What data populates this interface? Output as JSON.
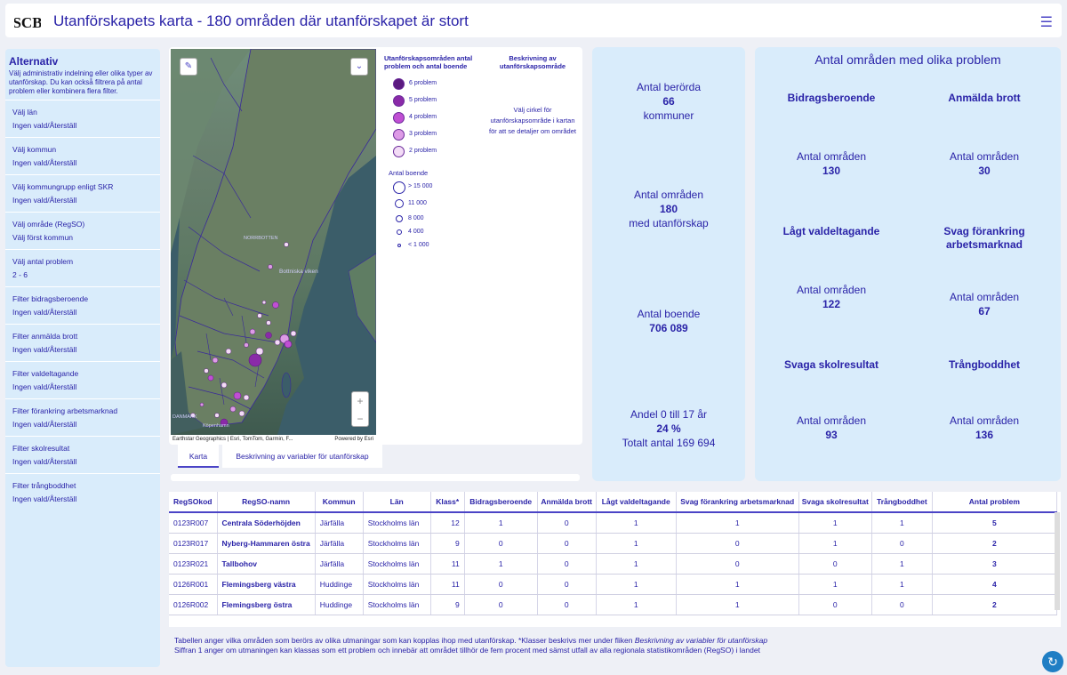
{
  "header": {
    "logo_text": "SCB",
    "title": "Utanförskapets karta - 180 områden där utanförskapet är stort",
    "menu_icon": "hamburger-icon"
  },
  "sidebar": {
    "title": "Alternativ",
    "description": "Välj  administrativ indelning eller olika typer av utanförskap. Du kan också filtrera på antal problem eller kombinera flera filter.",
    "items": [
      {
        "label": "Välj län",
        "value": "Ingen vald/Återställ"
      },
      {
        "label": "Välj kommun",
        "value": "Ingen vald/Återställ"
      },
      {
        "label": "Välj kommungrupp enligt SKR",
        "value": "Ingen vald/Återställ"
      },
      {
        "label": "Välj område (RegSO)",
        "value": "Välj först kommun"
      },
      {
        "label": "Välj antal problem",
        "value": "2 - 6"
      },
      {
        "label": "Filter bidragsberoende",
        "value": "Ingen vald/Återställ"
      },
      {
        "label": "Filter anmälda brott",
        "value": "Ingen vald/Återställ"
      },
      {
        "label": "Filter valdeltagande",
        "value": "Ingen vald/Återställ"
      },
      {
        "label": "Filter förankring arbetsmarknad",
        "value": "Ingen vald/Återställ"
      },
      {
        "label": "Filter skolresultat",
        "value": "Ingen vald/Återställ"
      },
      {
        "label": "Filter trångboddhet",
        "value": "Ingen vald/Återställ"
      }
    ]
  },
  "map": {
    "labels": {
      "bothnian": "Bottniska viken",
      "norrbotten": "NORRBOTTEN",
      "danmark": "DANMARK",
      "kopenhamn": "Köpenhamn"
    },
    "attribution": "Earthstar Geographics | Esri, TomTom, Garmin, F...",
    "powered": "Powered by Esri",
    "zoom_in": "+",
    "zoom_out": "−",
    "tool_icons": [
      "pencil-icon",
      "chevron-down-icon"
    ]
  },
  "legend": {
    "title": "Utanförskapsområden antal problem och antal boende",
    "problems": [
      {
        "label": "6 problem",
        "color": "#5b1a80"
      },
      {
        "label": "5 problem",
        "color": "#8a2aa8"
      },
      {
        "label": "4 problem",
        "color": "#c04fd3"
      },
      {
        "label": "3 problem",
        "color": "#dd9be6"
      },
      {
        "label": "2 problem",
        "color": "#f3dcf6"
      }
    ],
    "size_title": "Antal boende",
    "sizes": [
      "> 15 000",
      "11 000",
      "8 000",
      "4 000",
      "< 1 000"
    ],
    "desc_title": "Beskrivning av utanförskapsområde",
    "desc_text": "Välj cirkel för utanförskapsområde i kartan för att se detaljer om området"
  },
  "tabs": [
    "Karta",
    "Beskrivning av variabler för utanförskap"
  ],
  "stats": {
    "s1_top": "Antal berörda",
    "s1_val": "66",
    "s1_bottom": "kommuner",
    "s2_top": "Antal områden",
    "s2_val": "180",
    "s2_bottom": "med utanförskap",
    "s3_top": "Antal boende",
    "s3_val": "706 089",
    "s4_top": "Andel 0 till 17 år",
    "s4_val": "24 %",
    "s4_bottom": "Totalt antal 169 694"
  },
  "problems": {
    "title": "Antal områden med olika problem",
    "area_label": "Antal områden",
    "items": [
      {
        "name": "Bidragsberoende",
        "value": "130"
      },
      {
        "name": "Anmälda brott",
        "value": "30"
      },
      {
        "name": "Lågt valdeltagande",
        "value": "122"
      },
      {
        "name": "Svag förankring arbetsmarknad",
        "value": "67"
      },
      {
        "name": "Svaga skolresultat",
        "value": "93"
      },
      {
        "name": "Trångboddhet",
        "value": "136"
      }
    ]
  },
  "table": {
    "headers": [
      "RegSOkod",
      "RegSO-namn",
      "Kommun",
      "Län",
      "Klass*",
      "Bidragsberoende",
      "Anmälda brott",
      "Lågt valdeltagande",
      "Svag förankring arbetsmarknad",
      "Svaga skolresultat",
      "Trångboddhet",
      "Antal problem"
    ],
    "rows": [
      [
        "0123R007",
        "Centrala Söderhöjden",
        "Järfälla",
        "Stockholms län",
        "12",
        "1",
        "0",
        "1",
        "1",
        "1",
        "1",
        "5"
      ],
      [
        "0123R017",
        "Nyberg-Hammaren östra",
        "Järfälla",
        "Stockholms län",
        "9",
        "0",
        "0",
        "1",
        "0",
        "1",
        "0",
        "2"
      ],
      [
        "0123R021",
        "Tallbohov",
        "Järfälla",
        "Stockholms län",
        "11",
        "1",
        "0",
        "1",
        "0",
        "0",
        "1",
        "3"
      ],
      [
        "0126R001",
        "Flemingsberg västra",
        "Huddinge",
        "Stockholms län",
        "11",
        "0",
        "0",
        "1",
        "1",
        "1",
        "1",
        "4"
      ],
      [
        "0126R002",
        "Flemingsberg östra",
        "Huddinge",
        "Stockholms län",
        "9",
        "0",
        "0",
        "1",
        "1",
        "0",
        "0",
        "2"
      ]
    ]
  },
  "note": {
    "line1a": "Tabellen anger vilka områden som berörs av olika utmaningar som kan kopplas ihop med utanförskap. *Klasser beskrivs mer under fliken ",
    "line1b": "Beskrivning av variabler för utanförskap",
    "line2": "Siffran 1 anger om utmaningen kan klassas som ett problem och innebär att området tillhör de fem procent  med sämst utfall av alla regionala statistikområden (RegSO) i landet"
  }
}
